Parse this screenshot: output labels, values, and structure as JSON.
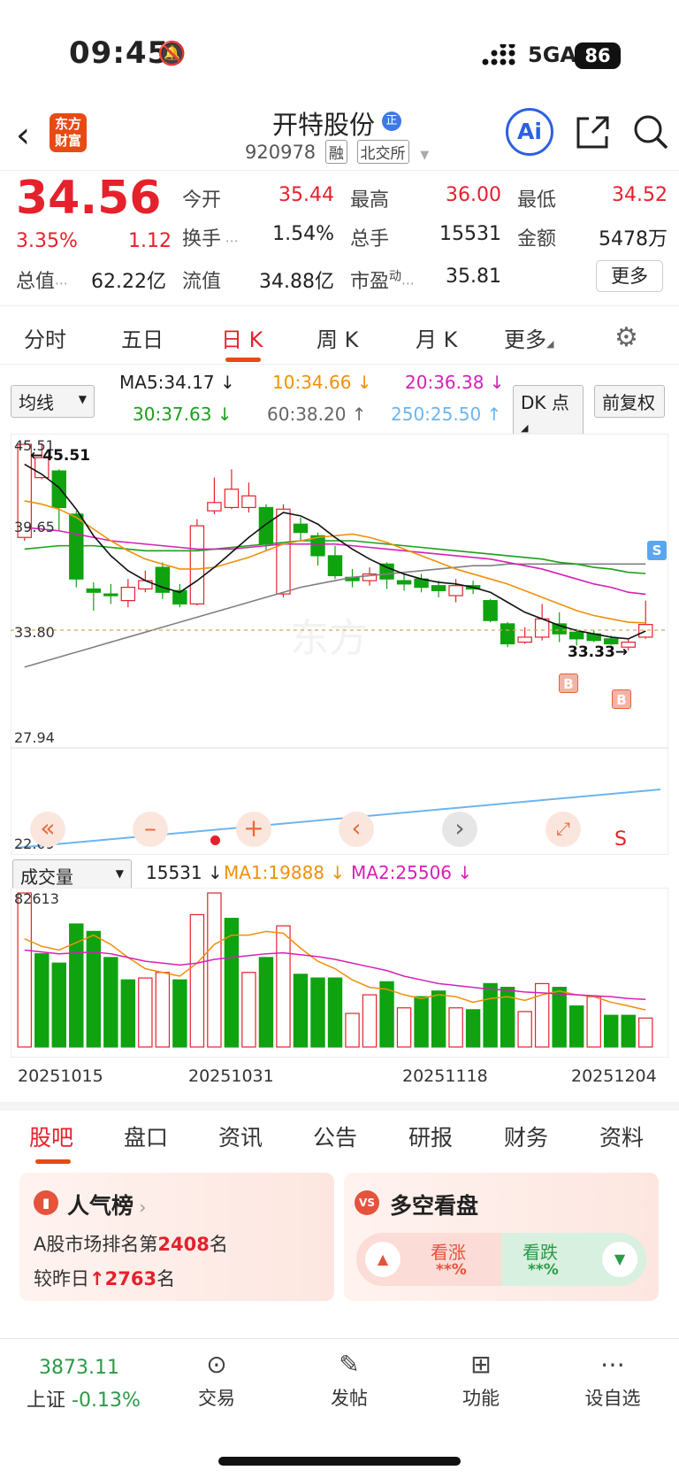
{
  "status_bar": {
    "time": "09:45",
    "network": "5GA",
    "battery": "86"
  },
  "header": {
    "logo": [
      "东方",
      "财富"
    ],
    "stock_name": "开特股份",
    "name_badge": "正",
    "code": "920978",
    "tag1": "融",
    "tag2": "北交所",
    "ai_label": "Ai"
  },
  "quote": {
    "price": "34.56",
    "change_pct": "3.35%",
    "change": "1.12",
    "open_label": "今开",
    "open": "35.44",
    "high_label": "最高",
    "high": "36.00",
    "low_label": "最低",
    "low": "34.52",
    "turnover_label": "换手",
    "turnover": "1.54%",
    "volume_label": "总手",
    "volume": "15531",
    "amount_label": "金额",
    "amount": "5478万",
    "mktcap_label": "总值",
    "mktcap": "62.22亿",
    "float_label": "流值",
    "float_cap": "34.88亿",
    "pe_label": "市盈",
    "pe_sup": "动",
    "pe": "35.81",
    "more_label": "更多"
  },
  "period_tabs": [
    "分时",
    "五日",
    "日 K",
    "周 K",
    "月 K",
    "更多"
  ],
  "active_period": 2,
  "ma_legend": {
    "selector": "均线",
    "ma5": "MA5:34.17 ↓",
    "ma10": "10:34.66 ↓",
    "ma20": "20:36.38 ↓",
    "ma30": "30:37.63 ↓",
    "ma60": "60:38.20 ↑",
    "ma250": "250:25.50 ↑",
    "dk_label": "DK 点",
    "adjust_label": "前复权"
  },
  "price_axis": {
    "top": "45.51",
    "mid1": "39.65",
    "mid2": "33.80",
    "bottom": "27.94",
    "sub": "22.09"
  },
  "price_annotations": {
    "high_marker": "45.51",
    "low_marker": "33.33",
    "buy": "B",
    "sell": "S",
    "s_label": "S"
  },
  "volume_legend": {
    "selector": "成交量",
    "vol": "15531 ↓",
    "ma1": "MA1:19888 ↓",
    "ma2": "MA2:25506 ↓",
    "top": "82613"
  },
  "dates": [
    "20251015",
    "20251031",
    "20251118",
    "20251204"
  ],
  "chart_data": {
    "type": "candlestick",
    "ylim": [
      27.94,
      45.51
    ],
    "candles": [
      {
        "o": 39.8,
        "c": 45.4,
        "h": 45.5,
        "l": 39.6
      },
      {
        "o": 43.4,
        "c": 44.6,
        "h": 45.4,
        "l": 43.3
      },
      {
        "o": 43.8,
        "c": 41.6,
        "h": 43.9,
        "l": 40.2
      },
      {
        "o": 41.2,
        "c": 37.3,
        "h": 41.4,
        "l": 36.8
      },
      {
        "o": 36.7,
        "c": 36.5,
        "h": 37.1,
        "l": 35.4
      },
      {
        "o": 36.4,
        "c": 36.3,
        "h": 37.0,
        "l": 35.8
      },
      {
        "o": 36.0,
        "c": 36.8,
        "h": 37.3,
        "l": 35.6
      },
      {
        "o": 36.7,
        "c": 37.2,
        "h": 37.8,
        "l": 36.5
      },
      {
        "o": 38.0,
        "c": 36.5,
        "h": 38.3,
        "l": 36.1
      },
      {
        "o": 36.6,
        "c": 35.8,
        "h": 37.0,
        "l": 35.6
      },
      {
        "o": 35.8,
        "c": 40.5,
        "h": 40.9,
        "l": 35.7
      },
      {
        "o": 41.4,
        "c": 41.9,
        "h": 43.4,
        "l": 41.2
      },
      {
        "o": 41.6,
        "c": 42.7,
        "h": 43.9,
        "l": 41.5
      },
      {
        "o": 41.6,
        "c": 42.3,
        "h": 43.1,
        "l": 41.3
      },
      {
        "o": 41.6,
        "c": 39.4,
        "h": 41.8,
        "l": 39.0
      },
      {
        "o": 36.4,
        "c": 41.5,
        "h": 41.8,
        "l": 36.2
      },
      {
        "o": 40.6,
        "c": 40.1,
        "h": 41.0,
        "l": 39.6
      },
      {
        "o": 39.9,
        "c": 38.7,
        "h": 40.1,
        "l": 38.1
      },
      {
        "o": 38.7,
        "c": 37.5,
        "h": 39.3,
        "l": 37.3
      },
      {
        "o": 37.4,
        "c": 37.2,
        "h": 37.9,
        "l": 36.8
      },
      {
        "o": 37.2,
        "c": 37.6,
        "h": 38.0,
        "l": 36.9
      },
      {
        "o": 38.2,
        "c": 37.3,
        "h": 38.3,
        "l": 36.7
      },
      {
        "o": 37.2,
        "c": 37.0,
        "h": 37.6,
        "l": 36.6
      },
      {
        "o": 37.3,
        "c": 36.8,
        "h": 37.6,
        "l": 36.5
      },
      {
        "o": 36.9,
        "c": 36.6,
        "h": 37.2,
        "l": 36.2
      },
      {
        "o": 36.3,
        "c": 36.9,
        "h": 37.3,
        "l": 35.9
      },
      {
        "o": 36.9,
        "c": 36.7,
        "h": 37.2,
        "l": 36.4
      },
      {
        "o": 36.0,
        "c": 34.8,
        "h": 36.1,
        "l": 34.7
      },
      {
        "o": 34.6,
        "c": 33.4,
        "h": 34.7,
        "l": 33.2
      },
      {
        "o": 33.5,
        "c": 33.8,
        "h": 34.4,
        "l": 33.4
      },
      {
        "o": 33.8,
        "c": 34.9,
        "h": 35.8,
        "l": 33.6
      },
      {
        "o": 34.6,
        "c": 34.0,
        "h": 35.3,
        "l": 33.5
      },
      {
        "o": 34.1,
        "c": 33.7,
        "h": 34.3,
        "l": 33.3
      },
      {
        "o": 34.0,
        "c": 33.6,
        "h": 34.2,
        "l": 33.5
      },
      {
        "o": 33.7,
        "c": 33.4,
        "h": 33.9,
        "l": 33.33
      },
      {
        "o": 33.2,
        "c": 33.5,
        "h": 33.7,
        "l": 33.0
      },
      {
        "o": 33.8,
        "c": 34.56,
        "h": 36.0,
        "l": 33.7
      }
    ],
    "ma5": [
      44.2,
      43.6,
      42.8,
      41.5,
      39.9,
      38.7,
      37.8,
      37.2,
      36.8,
      36.5,
      37.2,
      38.0,
      38.9,
      39.8,
      40.6,
      41.3,
      41.1,
      40.6,
      39.8,
      39.1,
      38.5,
      38.0,
      37.6,
      37.3,
      37.1,
      37.0,
      36.8,
      36.5,
      35.9,
      35.3,
      34.9,
      34.5,
      34.2,
      34.0,
      33.8,
      33.7,
      34.17
    ],
    "ma10": [
      42.0,
      41.8,
      41.5,
      41.0,
      40.3,
      39.6,
      39.0,
      38.5,
      38.2,
      37.9,
      37.9,
      38.0,
      38.3,
      38.6,
      39.0,
      39.4,
      39.6,
      39.8,
      39.9,
      40.0,
      39.8,
      39.5,
      39.1,
      38.7,
      38.3,
      37.9,
      37.6,
      37.3,
      37.0,
      36.6,
      36.2,
      35.8,
      35.4,
      35.1,
      34.9,
      34.7,
      34.66
    ],
    "ma20": [
      40.4,
      40.3,
      40.2,
      40.0,
      39.8,
      39.6,
      39.5,
      39.4,
      39.3,
      39.2,
      39.1,
      39.1,
      39.1,
      39.2,
      39.3,
      39.4,
      39.4,
      39.4,
      39.4,
      39.3,
      39.2,
      39.1,
      39.0,
      38.9,
      38.8,
      38.7,
      38.6,
      38.5,
      38.3,
      38.1,
      37.9,
      37.6,
      37.3,
      37.0,
      36.8,
      36.5,
      36.38
    ],
    "ma30": [
      39.1,
      39.2,
      39.3,
      39.3,
      39.3,
      39.2,
      39.1,
      39.0,
      39.0,
      39.0,
      39.0,
      39.1,
      39.2,
      39.3,
      39.4,
      39.5,
      39.6,
      39.6,
      39.6,
      39.6,
      39.5,
      39.4,
      39.3,
      39.2,
      39.1,
      39.0,
      38.9,
      38.8,
      38.7,
      38.6,
      38.5,
      38.3,
      38.2,
      38.0,
      37.9,
      37.7,
      37.63
    ],
    "ma60": [
      32.0,
      32.3,
      32.6,
      32.9,
      33.2,
      33.5,
      33.8,
      34.1,
      34.4,
      34.7,
      35.0,
      35.3,
      35.6,
      35.9,
      36.2,
      36.5,
      36.8,
      37.0,
      37.2,
      37.4,
      37.5,
      37.6,
      37.7,
      37.8,
      37.9,
      38.0,
      38.1,
      38.1,
      38.2,
      38.2,
      38.2,
      38.2,
      38.2,
      38.2,
      38.2,
      38.2,
      38.2
    ],
    "ma250": [
      22.09,
      22.2,
      22.4,
      22.6,
      22.8,
      22.9,
      23.0,
      23.1,
      23.2,
      23.3,
      23.4,
      23.5,
      23.6,
      23.7,
      23.8,
      23.9,
      24.0,
      24.1,
      24.2,
      24.3,
      24.4,
      24.5,
      24.6,
      24.7,
      24.8,
      24.9,
      25.0,
      25.05,
      25.1,
      25.15,
      25.2,
      25.25,
      25.3,
      25.35,
      25.4,
      25.45,
      25.5
    ],
    "volume": [
      82613,
      50000,
      45000,
      66000,
      62000,
      48000,
      36000,
      37000,
      40000,
      36000,
      71000,
      82613,
      69000,
      40000,
      48000,
      65000,
      39000,
      37000,
      37000,
      18000,
      28000,
      35000,
      21000,
      27000,
      30000,
      21000,
      20000,
      34000,
      32000,
      19000,
      34000,
      32000,
      22000,
      27000,
      17000,
      17000,
      15531
    ],
    "vol_up": [
      1,
      0,
      0,
      0,
      0,
      0,
      0,
      1,
      1,
      0,
      1,
      1,
      0,
      1,
      0,
      1,
      0,
      0,
      0,
      1,
      1,
      0,
      1,
      0,
      0,
      1,
      0,
      0,
      0,
      1,
      1,
      0,
      0,
      1,
      0,
      0,
      1
    ],
    "vol_ma1": [
      58000,
      54000,
      52000,
      56000,
      60000,
      55000,
      48000,
      42000,
      40000,
      38000,
      45000,
      55000,
      60000,
      60000,
      62000,
      61000,
      53000,
      46000,
      42000,
      36000,
      32000,
      31000,
      28000,
      26000,
      28000,
      27000,
      24000,
      26000,
      27000,
      25000,
      28000,
      30000,
      28000,
      27000,
      24000,
      22000,
      19888
    ],
    "vol_ma2": [
      52000,
      51000,
      50000,
      50500,
      51000,
      50000,
      48000,
      46000,
      45000,
      44000,
      45000,
      47000,
      48000,
      49000,
      50000,
      50500,
      49500,
      48500,
      47000,
      45000,
      43000,
      41000,
      38000,
      36000,
      34000,
      33000,
      32000,
      31000,
      30500,
      29500,
      29000,
      28500,
      28000,
      27500,
      27000,
      26000,
      25506
    ],
    "vol_ylim": [
      0,
      82613
    ]
  },
  "chart_controls": {
    "zoom_out": "–",
    "zoom_in": "+"
  },
  "bottom_tabs": [
    "股吧",
    "盘口",
    "资讯",
    "公告",
    "研报",
    "财务",
    "资料"
  ],
  "popularity": {
    "title": "人气榜",
    "rank_prefix": "A股市场排名第",
    "rank": "2408",
    "rank_suffix": "名",
    "change_prefix": "较昨日",
    "change": "2763",
    "change_suffix": "名"
  },
  "bull_bear": {
    "title": "多空看盘",
    "bull": "看涨",
    "bull_pct": "**%",
    "bear": "看跌",
    "bear_pct": "**%"
  },
  "tabbar": {
    "index_value": "3873.11",
    "index_name": "上证",
    "index_change": "-0.13%",
    "trade": "交易",
    "post": "发帖",
    "functions": "功能",
    "watchlist": "设自选"
  }
}
